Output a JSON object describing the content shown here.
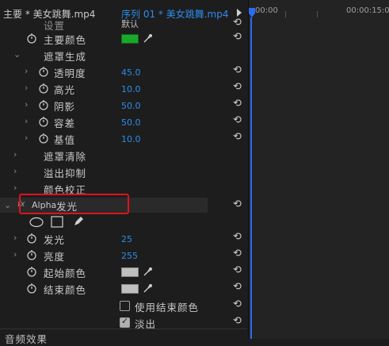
{
  "header": {
    "source_tab": "主要 * 美女跳舞.mp4",
    "sequence_tab": "序列 01 * 美女跳舞.mp4",
    "timecode_start": "00:00",
    "timecode_end": "00:00:15:0"
  },
  "partial_top": {
    "label": "设置",
    "value": "默认"
  },
  "main_color": {
    "label": "主要颜色",
    "color": "#1aa82a"
  },
  "matte_generation": {
    "label": "遮罩生成",
    "params": [
      {
        "label": "透明度",
        "value": "45.0"
      },
      {
        "label": "高光",
        "value": "10.0"
      },
      {
        "label": "阴影",
        "value": "50.0"
      },
      {
        "label": "容差",
        "value": "50.0"
      },
      {
        "label": "基值",
        "value": "10.0"
      }
    ]
  },
  "groups": [
    {
      "label": "遮罩清除"
    },
    {
      "label": "溢出抑制"
    },
    {
      "label": "颜色校正"
    }
  ],
  "alpha_glow": {
    "fx": "fx",
    "name_en": "Alpha",
    "name_cn": "发光",
    "params": [
      {
        "label": "发光",
        "value": "25"
      },
      {
        "label": "亮度",
        "value": "255"
      }
    ],
    "start_color": {
      "label": "起始颜色",
      "color": "#bfbfbf"
    },
    "end_color": {
      "label": "结束颜色",
      "color": "#bfbfbf"
    },
    "use_end_color": {
      "label": "使用结束颜色",
      "checked": false
    },
    "fade_out": {
      "label": "淡出",
      "checked": true
    }
  },
  "audio_effects": {
    "label": "音频效果"
  }
}
